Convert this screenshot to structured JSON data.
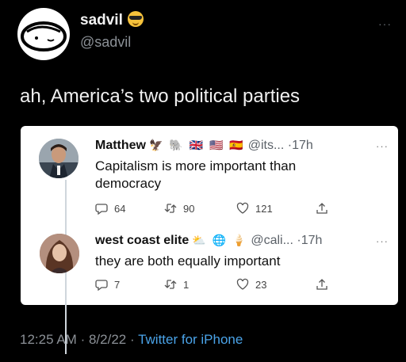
{
  "author": {
    "name": "sadvil",
    "handle": "@sadvil",
    "more": "···"
  },
  "tweet": {
    "text": "ah, America’s two political parties",
    "time": "12:25 AM",
    "date": "8/2/22",
    "source": "Twitter for iPhone"
  },
  "replies": [
    {
      "name": "Matthew",
      "badges": "🦅 🐘 🇬🇧 🇺🇸 🇪🇸",
      "handle": "@its...",
      "age": "·17h",
      "more": "···",
      "body": "Capitalism is more important than democracy",
      "reply_count": "64",
      "retweet_count": "90",
      "like_count": "121"
    },
    {
      "name": "west coast elite",
      "badges": "⛅ 🌐 🍦",
      "handle": "@cali...",
      "age": "·17h",
      "more": "···",
      "body": "they are both equally important",
      "reply_count": "7",
      "retweet_count": "1",
      "like_count": "23"
    }
  ],
  "colors": {
    "background": "#000000",
    "card": "#ffffff",
    "link": "#4aa3e8",
    "muted": "#8b9096"
  }
}
